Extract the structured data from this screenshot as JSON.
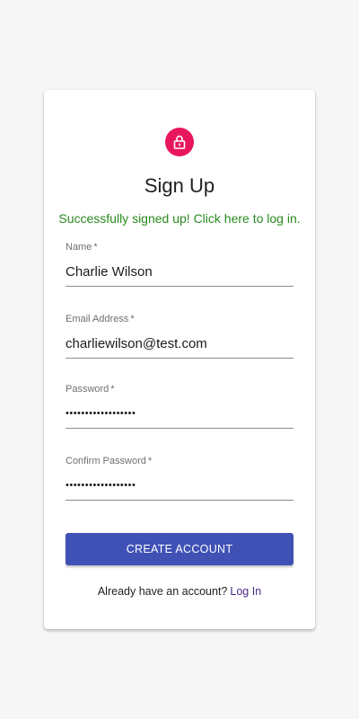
{
  "colors": {
    "accent": "#3f51b5",
    "lock_badge": "#e8175d",
    "success_text": "#2a8a1f",
    "link": "#4a2a8a"
  },
  "icons": {
    "lock": "lock-icon"
  },
  "form": {
    "title": "Sign Up",
    "success_message": "Successfully signed up! Click here to log in.",
    "fields": {
      "name": {
        "label": "Name",
        "required_mark": "*",
        "value": "Charlie Wilson"
      },
      "email": {
        "label": "Email Address",
        "required_mark": "*",
        "value": "charliewilson@test.com"
      },
      "password": {
        "label": "Password",
        "required_mark": "*",
        "value": "••••••••••••••••••"
      },
      "confirm_password": {
        "label": "Confirm Password",
        "required_mark": "*",
        "value": "••••••••••••••••••"
      }
    },
    "submit_label": "CREATE ACCOUNT",
    "footer_text": "Already have an account?",
    "login_link": "Log In"
  }
}
